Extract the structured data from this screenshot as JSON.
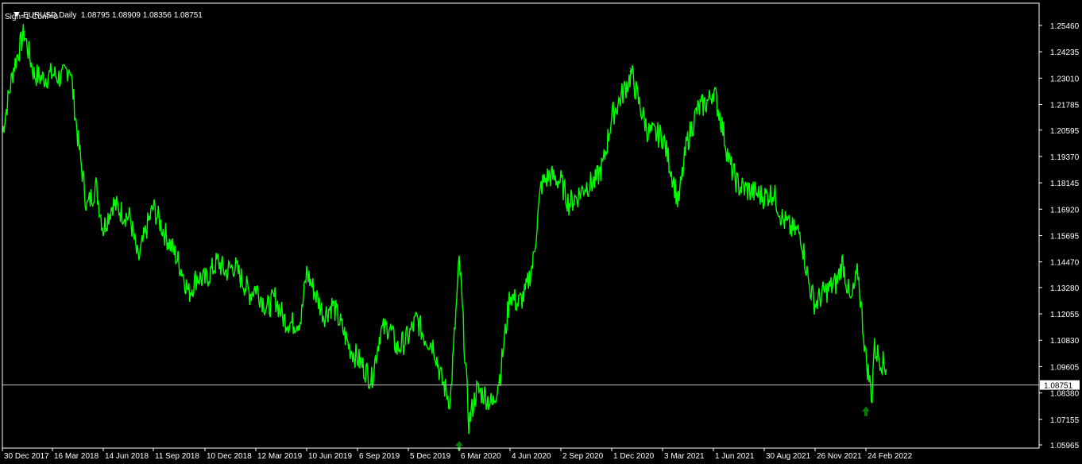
{
  "header": {
    "symbol_period": "EURUSD,Daily",
    "ohlc": "1.08795 1.08909 1.08356 1.08751",
    "indicator_line": "Sign=1 Conf=0"
  },
  "colors": {
    "background": "#000000",
    "price_line": "#00ff00",
    "arrow_marker": "#008000",
    "axis": "#ffffff",
    "current_price_line": "#c0c0c0"
  },
  "icons": {
    "dropdown": "triangle-down-icon",
    "buy_arrow": "up-arrow-icon",
    "cross_marker": "x-marker-icon"
  },
  "chart_data": {
    "type": "line",
    "title": "EURUSD,Daily",
    "xlabel": "",
    "ylabel": "",
    "ylim": [
      1.0565,
      1.2617
    ],
    "grid": false,
    "y_ticks": [
      "1.25460",
      "1.24235",
      "1.23010",
      "1.21785",
      "1.20595",
      "1.19370",
      "1.18145",
      "1.16920",
      "1.15695",
      "1.14470",
      "1.13280",
      "1.12055",
      "1.10830",
      "1.09605",
      "1.08380",
      "1.07155",
      "1.05965"
    ],
    "x_ticks": [
      "30 Dec 2017",
      "16 Mar 2018",
      "14 Jun 2018",
      "11 Sep 2018",
      "10 Dec 2018",
      "12 Mar 2019",
      "10 Jun 2019",
      "6 Sep 2019",
      "5 Dec 2019",
      "6 Mar 2020",
      "4 Jun 2020",
      "2 Sep 2020",
      "1 Dec 2020",
      "3 Mar 2021",
      "1 Jun 2021",
      "30 Aug 2021",
      "26 Nov 2021",
      "24 Feb 2022"
    ],
    "current_price": "1.08751",
    "series": [
      {
        "x": [
          "30 Dec 2017",
          "16 Jan 2018",
          "1 Feb 2018",
          "16 Feb 2018",
          "1 Mar 2018",
          "16 Mar 2018",
          "2 Apr 2018",
          "16 Apr 2018",
          "1 May 2018",
          "16 May 2018",
          "1 Jun 2018",
          "14 Jun 2018",
          "1 Jul 2018",
          "16 Jul 2018",
          "1 Aug 2018",
          "15 Aug 2018",
          "1 Sep 2018",
          "11 Sep 2018",
          "1 Oct 2018",
          "16 Oct 2018",
          "1 Nov 2018",
          "12 Nov 2018",
          "26 Nov 2018",
          "10 Dec 2018",
          "2 Jan 2019",
          "16 Jan 2019",
          "1 Feb 2019",
          "18 Feb 2019",
          "1 Mar 2019",
          "12 Mar 2019",
          "1 Apr 2019",
          "15 Apr 2019",
          "1 May 2019",
          "16 May 2019",
          "31 May 2019",
          "10 Jun 2019",
          "25 Jun 2019",
          "10 Jul 2019",
          "25 Jul 2019",
          "9 Aug 2019",
          "23 Aug 2019",
          "6 Sep 2019",
          "1 Oct 2019",
          "16 Oct 2019",
          "1 Nov 2019",
          "15 Nov 2019",
          "5 Dec 2019",
          "20 Dec 2019",
          "3 Jan 2020",
          "20 Jan 2020",
          "3 Feb 2020",
          "19 Feb 2020",
          "6 Mar 2020",
          "9 Mar 2020",
          "23 Mar 2020",
          "6 Apr 2020",
          "20 Apr 2020",
          "4 May 2020",
          "18 May 2020",
          "4 Jun 2020",
          "18 Jun 2020",
          "1 Jul 2020",
          "15 Jul 2020",
          "29 Jul 2020",
          "12 Aug 2020",
          "2 Sep 2020",
          "16 Sep 2020",
          "1 Oct 2020",
          "15 Oct 2020",
          "2 Nov 2020",
          "16 Nov 2020",
          "1 Dec 2020",
          "6 Jan 2021",
          "20 Jan 2021",
          "5 Feb 2021",
          "3 Mar 2021",
          "16 Mar 2021",
          "31 Mar 2021",
          "15 Apr 2021",
          "3 May 2021",
          "25 May 2021",
          "1 Jun 2021",
          "15 Jun 2021",
          "30 Jun 2021",
          "15 Jul 2021",
          "30 Aug 2021",
          "15 Sep 2021",
          "30 Sep 2021",
          "15 Oct 2021",
          "1 Nov 2021",
          "15 Nov 2021",
          "26 Nov 2021",
          "10 Dec 2021",
          "3 Jan 2022",
          "14 Jan 2022",
          "28 Jan 2022",
          "10 Feb 2022",
          "24 Feb 2022",
          "7 Mar 2022",
          "10 Mar 2022",
          "21 Mar 2022",
          "1 Apr 2022"
        ],
        "values": [
          1.205,
          1.235,
          1.251,
          1.232,
          1.23,
          1.232,
          1.23,
          1.236,
          1.2,
          1.17,
          1.18,
          1.16,
          1.172,
          1.168,
          1.165,
          1.145,
          1.162,
          1.17,
          1.158,
          1.15,
          1.14,
          1.13,
          1.138,
          1.136,
          1.145,
          1.14,
          1.143,
          1.135,
          1.13,
          1.133,
          1.123,
          1.128,
          1.118,
          1.116,
          1.118,
          1.14,
          1.13,
          1.12,
          1.125,
          1.115,
          1.105,
          1.1,
          1.09,
          1.112,
          1.115,
          1.104,
          1.11,
          1.118,
          1.11,
          1.106,
          1.09,
          1.08,
          1.145,
          1.135,
          1.07,
          1.085,
          1.083,
          1.078,
          1.093,
          1.13,
          1.125,
          1.13,
          1.145,
          1.18,
          1.185,
          1.182,
          1.172,
          1.175,
          1.18,
          1.182,
          1.19,
          1.212,
          1.232,
          1.218,
          1.205,
          1.203,
          1.19,
          1.172,
          1.2,
          1.215,
          1.22,
          1.225,
          1.21,
          1.19,
          1.18,
          1.175,
          1.177,
          1.165,
          1.16,
          1.158,
          1.135,
          1.125,
          1.13,
          1.135,
          1.145,
          1.125,
          1.14,
          1.1,
          1.082,
          1.105,
          1.1,
          1.095
        ]
      }
    ],
    "markers": [
      {
        "type": "x",
        "x": "1 Feb 2018",
        "value": 1.25
      },
      {
        "type": "x",
        "x": "6 Jan 2021",
        "value": 1.233
      },
      {
        "type": "up_arrow",
        "x": "6 Mar 2020",
        "value": 1.06
      },
      {
        "type": "up_arrow",
        "x": "24 Feb 2022",
        "value": 1.076
      }
    ]
  }
}
